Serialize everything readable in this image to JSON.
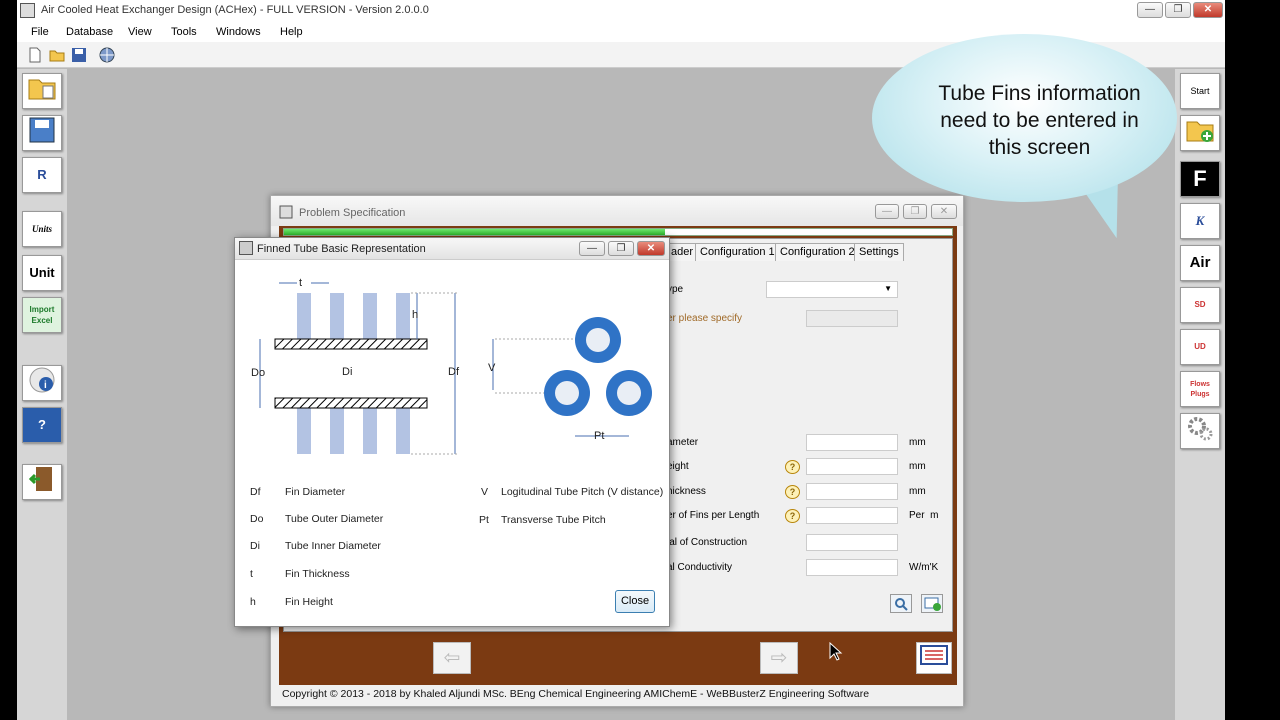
{
  "window": {
    "title": "Air Cooled Heat Exchanger Design (ACHex) - FULL VERSION - Version 2.0.0.0"
  },
  "menu": [
    "File",
    "Database",
    "View",
    "Tools",
    "Windows",
    "Help"
  ],
  "sidebar_left": [
    {
      "icon": "open-folder-icon"
    },
    {
      "icon": "save-icon"
    },
    {
      "icon": "report-icon",
      "label": "R"
    },
    {
      "icon": "units-icon",
      "label": "Units"
    },
    {
      "icon": "unit-icon",
      "label": "Unit"
    },
    {
      "icon": "import-excel-icon",
      "label": "Import Excel"
    },
    {
      "icon": "info-icon"
    },
    {
      "icon": "help-book-icon",
      "label": "?"
    },
    {
      "icon": "exit-door-icon"
    }
  ],
  "sidebar_right": [
    {
      "icon": "start-icon",
      "label": "Start"
    },
    {
      "icon": "add-folder-icon"
    },
    {
      "icon": "fluid-icon",
      "label": "F"
    },
    {
      "icon": "k-coil-icon",
      "label": "K"
    },
    {
      "icon": "air-icon",
      "label": "Air"
    },
    {
      "icon": "sd-book-icon",
      "label": "SD"
    },
    {
      "icon": "ud-book-icon",
      "label": "UD"
    },
    {
      "icon": "flows-book-icon",
      "label": "Flows Plugs"
    },
    {
      "icon": "gears-icon"
    }
  ],
  "bubble": {
    "line1": "Tube Fins information",
    "line2": "need to be entered in",
    "line3": "this screen"
  },
  "problem_spec": {
    "title": "Problem Specification",
    "progress": 0.57,
    "tabs": [
      "ader",
      "Configuration 1",
      "Configuration 2",
      "Settings"
    ],
    "labels": {
      "type": "ype",
      "other": "er please specify",
      "fin_diameter": "ameter",
      "fin_height": "eight",
      "fin_thickness": "hickness",
      "fins_per_length": "er of Fins per Length",
      "material": "ial of Construction",
      "conductivity": "al Conductivity"
    },
    "units": {
      "fin_diameter": "mm",
      "fin_height": "mm",
      "fin_thickness": "mm",
      "fins_per_length": "Per  m",
      "conductivity": "W/m'K"
    },
    "copyright": "Copyright © 2013 - 2018 by Khaled Aljundi MSc. BEng Chemical Engineering AMIChemE - WeBBusterZ Engineering Software"
  },
  "finned_tube": {
    "title": "Finned Tube Basic Representation",
    "diagram_labels": {
      "t": "t",
      "h": "h",
      "do": "Do",
      "di": "Di",
      "df": "Df",
      "v": "V",
      "pt": "Pt"
    },
    "legend": [
      {
        "sym": "Df",
        "text": "Fin Diameter"
      },
      {
        "sym": "Do",
        "text": "Tube Outer Diameter"
      },
      {
        "sym": "Di",
        "text": "Tube Inner Diameter"
      },
      {
        "sym": "t",
        "text": "Fin Thickness"
      },
      {
        "sym": "h",
        "text": "Fin Height"
      }
    ],
    "legend2": [
      {
        "sym": "V",
        "text": "Logitudinal Tube Pitch (V distance)"
      },
      {
        "sym": "Pt",
        "text": "Transverse Tube Pitch"
      }
    ],
    "close_label": "Close"
  }
}
